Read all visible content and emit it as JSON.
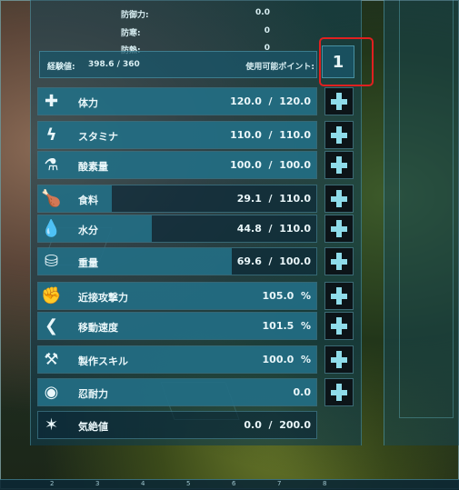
{
  "resistances": [
    {
      "label": "防御力:",
      "value": "0.0"
    },
    {
      "label": "防寒:",
      "value": "0"
    },
    {
      "label": "防熱:",
      "value": "0"
    }
  ],
  "experience": {
    "label": "経験値:",
    "value": "398.6 / 360"
  },
  "points": {
    "label": "使用可能ポイント:",
    "value": "1"
  },
  "stats": [
    {
      "icon": "plus-icon",
      "glyph": "✚",
      "label": "体力",
      "value": "120.0  /  120.0",
      "fill": 1.0,
      "upgrade": true
    },
    {
      "icon": "lightning-icon",
      "glyph": "ϟ",
      "label": "スタミナ",
      "value": "110.0  /  110.0",
      "fill": 1.0,
      "upgrade": true
    },
    {
      "icon": "oxygen-tank-icon",
      "glyph": "⚗",
      "label": "酸素量",
      "value": "100.0  /  100.0",
      "fill": 1.0,
      "upgrade": true
    },
    {
      "icon": "food-icon",
      "glyph": "🍗",
      "label": "食料",
      "value": "29.1  /  110.0",
      "fill": 0.264,
      "upgrade": true
    },
    {
      "icon": "water-drop-icon",
      "glyph": "💧",
      "label": "水分",
      "value": "44.8  /  110.0",
      "fill": 0.407,
      "upgrade": true
    },
    {
      "icon": "weight-icon",
      "glyph": "⛁",
      "label": "重量",
      "value": "69.6  /  100.0",
      "fill": 0.696,
      "upgrade": true
    },
    {
      "icon": "fist-icon",
      "glyph": "✊",
      "label": "近接攻撃力",
      "value": "105.0  %",
      "fill": 1.0,
      "upgrade": true
    },
    {
      "icon": "speed-icon",
      "glyph": "❮",
      "label": "移動速度",
      "value": "101.5  %",
      "fill": 1.0,
      "upgrade": true
    },
    {
      "icon": "tools-icon",
      "glyph": "⚒",
      "label": "製作スキル",
      "value": "100.0  %",
      "fill": 1.0,
      "upgrade": true
    },
    {
      "icon": "brain-icon",
      "glyph": "◉",
      "label": "忍耐力",
      "value": "0.0",
      "fill": 1.0,
      "upgrade": true
    },
    {
      "icon": "torpor-icon",
      "glyph": "✶",
      "label": "気絶値",
      "value": "0.0  /  200.0",
      "fill": 0.0,
      "upgrade": false
    }
  ],
  "hotbar": [
    "2",
    "3",
    "4",
    "5",
    "6",
    "7",
    "8"
  ]
}
